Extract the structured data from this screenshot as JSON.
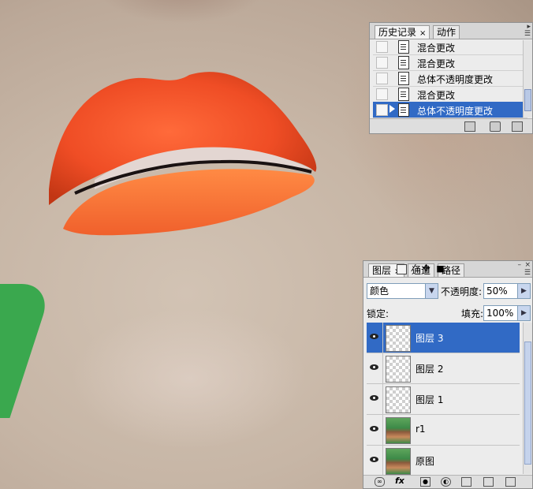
{
  "history_panel": {
    "tabs": [
      {
        "label": "历史记录",
        "close": "×",
        "active": true
      },
      {
        "label": "动作",
        "active": false
      }
    ],
    "items": [
      {
        "label": "混合更改",
        "selected": false
      },
      {
        "label": "混合更改",
        "selected": false
      },
      {
        "label": "总体不透明度更改",
        "selected": false
      },
      {
        "label": "混合更改",
        "selected": false
      },
      {
        "label": "总体不透明度更改",
        "selected": true
      }
    ],
    "footer_icons": [
      "new-document-icon",
      "snapshot-camera-icon",
      "trash-icon"
    ]
  },
  "layers_panel": {
    "tabs": [
      {
        "label": "图层",
        "close": "×",
        "active": true
      },
      {
        "label": "通道",
        "active": false
      },
      {
        "label": "路径",
        "active": false
      }
    ],
    "blend_mode": "颜色",
    "opacity_label": "不透明度:",
    "opacity_value": "50%",
    "lock_label": "锁定:",
    "fill_label": "填充:",
    "fill_value": "100%",
    "layers": [
      {
        "name": "图层 3",
        "thumbnail": "transparent",
        "visible": true,
        "selected": true
      },
      {
        "name": "图层 2",
        "thumbnail": "transparent",
        "visible": true,
        "selected": false
      },
      {
        "name": "图层 1",
        "thumbnail": "transparent",
        "visible": true,
        "selected": false
      },
      {
        "name": "r1",
        "thumbnail": "photo",
        "visible": true,
        "selected": false
      },
      {
        "name": "原图",
        "thumbnail": "photo",
        "visible": true,
        "selected": false
      }
    ],
    "footer_icons": [
      "link-layers-icon",
      "fx-icon",
      "add-mask-icon",
      "adjustment-layer-icon",
      "new-group-icon",
      "new-layer-icon",
      "delete-layer-icon"
    ],
    "footer_fx_label": "fx"
  },
  "colors": {
    "selection": "#316ac5",
    "lip": "#f2512a",
    "skin": "#c7b6a6",
    "background_green": "#3aa84e"
  }
}
